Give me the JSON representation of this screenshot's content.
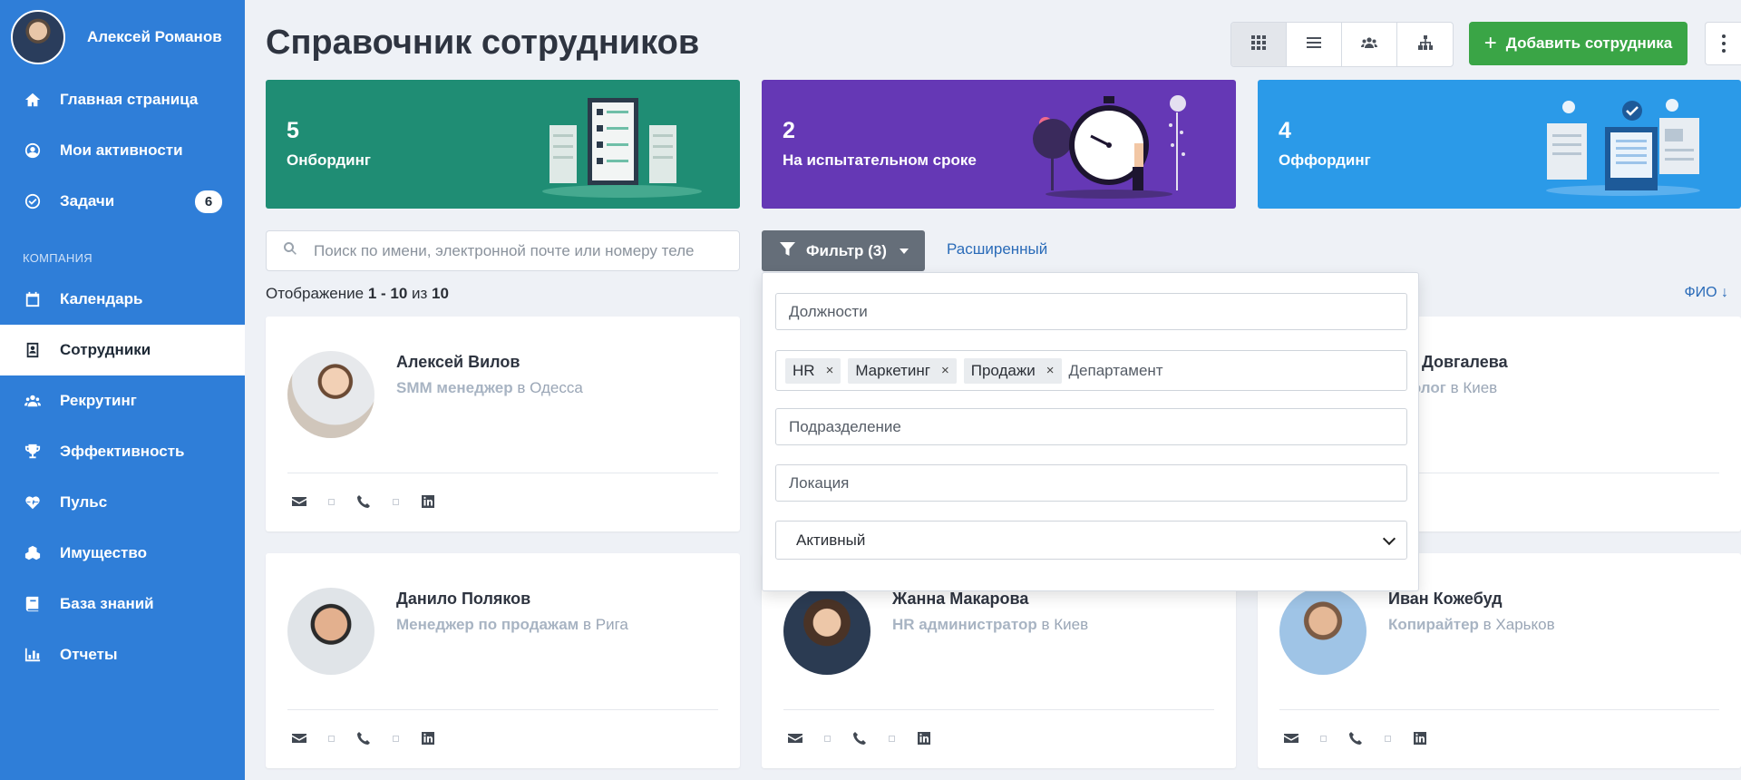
{
  "profile": {
    "name": "Алексей Романов"
  },
  "sidebar": {
    "items": [
      {
        "label": "Главная страница"
      },
      {
        "label": "Мои активности"
      },
      {
        "label": "Задачи",
        "badge": "6"
      }
    ],
    "section_label": "КОМПАНИЯ",
    "company_items": [
      {
        "label": "Календарь"
      },
      {
        "label": "Сотрудники"
      },
      {
        "label": "Рекрутинг"
      },
      {
        "label": "Эффективность"
      },
      {
        "label": "Пульс"
      },
      {
        "label": "Имущество"
      },
      {
        "label": "База знаний"
      },
      {
        "label": "Отчеты"
      }
    ],
    "active_item": "Сотрудники"
  },
  "header": {
    "title": "Справочник сотрудников",
    "add_button": "Добавить сотрудника",
    "view_modes": [
      "grid-view-icon",
      "list-view-icon",
      "team-view-icon",
      "org-chart-icon"
    ],
    "selected_view": "grid-view-icon"
  },
  "stats": [
    {
      "value": "5",
      "label": "Онбординг",
      "color": "#1f8d74"
    },
    {
      "value": "2",
      "label": "На испытательном сроке",
      "color": "#6538b5"
    },
    {
      "value": "4",
      "label": "Оффординг",
      "color": "#2b9ae8"
    }
  ],
  "search": {
    "placeholder": "Поиск по имени, электронной почте или номеру телефона"
  },
  "filter": {
    "button_label": "Фильтр (3)",
    "advanced_label": "Расширенный",
    "positions_placeholder": "Должности",
    "department_tags": [
      "HR",
      "Маркетинг",
      "Продажи"
    ],
    "department_placeholder": "Департамент",
    "division_placeholder": "Подразделение",
    "location_placeholder": "Локация",
    "status_value": "Активный"
  },
  "listing": {
    "prefix": "Отображение ",
    "range": "1 - 10",
    "of": " из ",
    "total": "10",
    "sort_label": "ФИО ↓"
  },
  "employees": [
    {
      "name": "Алексей Вилов",
      "role": "SMM менеджер",
      "in": " в ",
      "city": "Одесса"
    },
    {
      "name": "ина Довгалева",
      "role": "кетолог",
      "in": " в ",
      "city": "Киев"
    },
    {
      "name": "Данило Поляков",
      "role": "Менеджер по продажам",
      "in": " в ",
      "city": "Рига"
    },
    {
      "name": "Жанна Макарова",
      "role": "HR администратор",
      "in": " в ",
      "city": "Киев"
    },
    {
      "name": "Иван Кожебуд",
      "role": "Копирайтер",
      "in": " в ",
      "city": "Харьков"
    }
  ],
  "colors": {
    "sidebar": "#2f7ed8",
    "add_button": "#3aa546",
    "filter_button": "#656e79",
    "link": "#2a6bb8"
  }
}
